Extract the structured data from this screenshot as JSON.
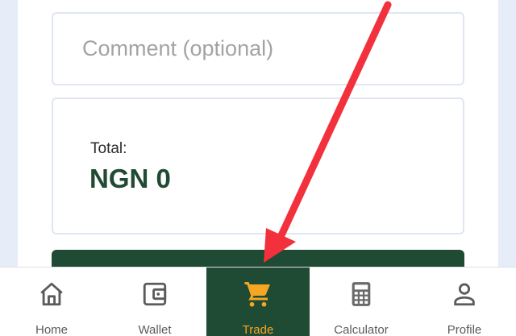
{
  "form": {
    "comment_placeholder": "Comment (optional)",
    "total_label": "Total:",
    "total_value": "NGN 0"
  },
  "nav": {
    "items": [
      {
        "label": "Home",
        "icon": "home-icon"
      },
      {
        "label": "Wallet",
        "icon": "wallet-icon"
      },
      {
        "label": "Trade",
        "icon": "cart-icon",
        "active": true
      },
      {
        "label": "Calculator",
        "icon": "calculator-icon"
      },
      {
        "label": "Profile",
        "icon": "person-icon"
      }
    ]
  },
  "colors": {
    "brand_green": "#1f4a33",
    "active_accent": "#f6a623",
    "annotation_arrow": "#f2313c"
  }
}
